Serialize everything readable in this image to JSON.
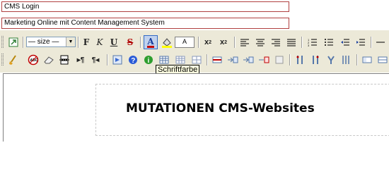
{
  "form": {
    "login_field_value": "CMS Login",
    "title_field_value": "Marketing Online mit Content Management System"
  },
  "toolbar": {
    "size_select_value": "— size —",
    "bg_color_preview": "A",
    "tooltip": "Schriftfarbe",
    "row1_icons": [
      "insert-link-icon",
      "size-select",
      "bold-icon",
      "italic-icon",
      "underline-icon",
      "strikethrough-icon",
      "font-color-icon",
      "background-color-icon",
      "subscript-icon",
      "superscript-icon",
      "align-left-icon",
      "align-center-icon",
      "align-right-icon",
      "align-justify-icon",
      "ordered-list-icon",
      "unordered-list-icon",
      "outdent-icon",
      "indent-icon",
      "horizontal-rule-icon"
    ],
    "row2_icons": [
      "clean-icon",
      "remove-format-icon",
      "eraser-icon",
      "page-break-icon",
      "ltr-icon",
      "rtl-icon",
      "image-icon",
      "help-icon",
      "info-icon",
      "table-icon",
      "table-props-icon",
      "cell-icon",
      "row-insert-icon",
      "row-before-icon",
      "row-after-icon",
      "row-delete-icon",
      "col-icon",
      "split-cell-icon",
      "merge-cell-icon",
      "col-before-icon",
      "col-after-icon",
      "form-icon",
      "more-icon"
    ]
  },
  "editor": {
    "heading": "MUTATIONEN CMS-Websites"
  },
  "colors": {
    "toolbar_bg": "#ece9d8",
    "field_border": "#b04040",
    "active_button": "#c1d2ee"
  }
}
